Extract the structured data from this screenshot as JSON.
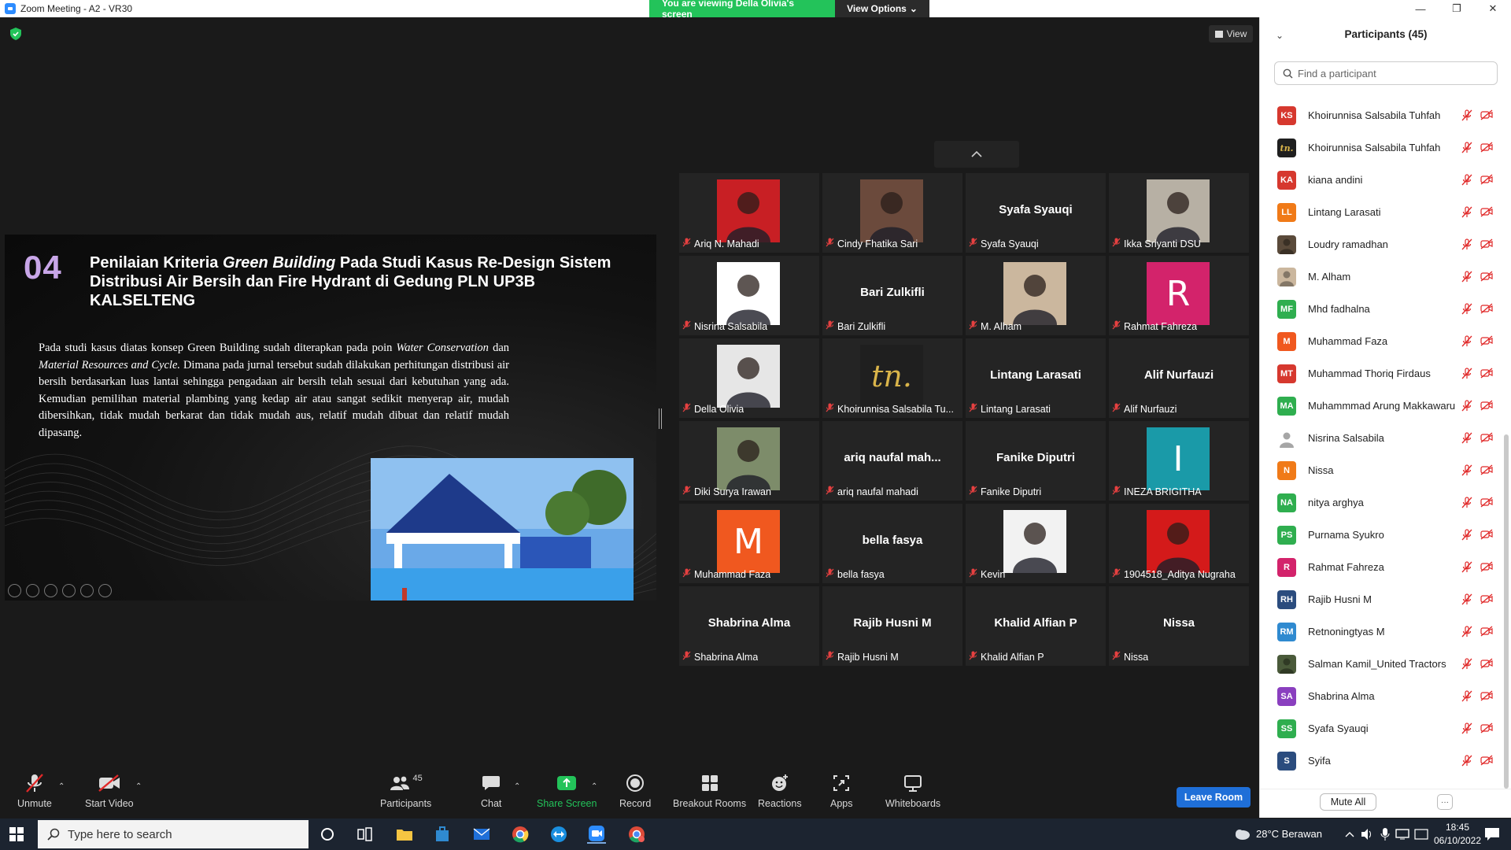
{
  "window": {
    "title": "Zoom Meeting - A2 - VR30",
    "banner_text": "You are viewing Della Olivia's screen",
    "view_options_label": "View Options",
    "view_label": "View"
  },
  "slide": {
    "number": "04",
    "title_part1": "Penilaian Kriteria ",
    "title_italic": "Green Building",
    "title_part2": " Pada Studi Kasus Re-Design Sistem Distribusi Air Bersih dan Fire Hydrant di Gedung PLN UP3B KALSELTENG",
    "body_part1": "Pada studi kasus diatas konsep Green Building sudah diterapkan pada poin ",
    "body_italic1": "Water Conservation",
    "body_part2": " dan ",
    "body_italic2": "Material Resources and Cycle.",
    "body_part3": " Dimana pada jurnal tersebut sudah dilakukan perhitungan distribusi air bersih berdasarkan luas lantai sehingga pengadaan air bersih telah sesuai dari kebutuhan yang ada. Kemudian pemilihan material plambing yang kedap air atau sangat sedikit menyerap air, mudah dibersihkan, tidak mudah berkarat dan tidak mudah aus, relatif mudah dibuat dan relatif mudah dipasang."
  },
  "gallery": [
    {
      "name": "Ariq N. Mahadi",
      "type": "photo",
      "color": "#c81f24"
    },
    {
      "name": "Cindy Fhatika Sari",
      "type": "photo",
      "color": "#6b4a3c"
    },
    {
      "name": "Syafa Syauqi",
      "type": "text",
      "big": "Syafa Syauqi"
    },
    {
      "name": "Ikka Sriyanti DSU",
      "type": "photo",
      "color": "#b7b0a4"
    },
    {
      "name": "Nisrina Salsabila",
      "type": "photo",
      "color": "#ffffff"
    },
    {
      "name": "Bari Zulkifli",
      "type": "text",
      "big": "Bari Zulkifli"
    },
    {
      "name": "M. Alham",
      "type": "photo",
      "color": "#cbb79e"
    },
    {
      "name": "Rahmat Fahreza",
      "type": "letter",
      "letter": "R",
      "color": "#d3236b"
    },
    {
      "name": "Della Olivia",
      "type": "photo",
      "color": "#e6e6e6"
    },
    {
      "name": "Khoirunnisa Salsabila Tu...",
      "type": "logo",
      "letter": "tn.",
      "color": "#1f1f1f"
    },
    {
      "name": "Lintang Larasati",
      "type": "text",
      "big": "Lintang Larasati"
    },
    {
      "name": "Alif Nurfauzi",
      "type": "text",
      "big": "Alif Nurfauzi"
    },
    {
      "name": "Diki Surya Irawan",
      "type": "photo",
      "color": "#7d8c6a"
    },
    {
      "name": "ariq naufal mahadi",
      "type": "text",
      "big": "ariq naufal mah..."
    },
    {
      "name": "Fanike Diputri",
      "type": "text",
      "big": "Fanike Diputri"
    },
    {
      "name": "INEZA BRIGITHA",
      "type": "letter",
      "letter": "I",
      "color": "#1a9aa8"
    },
    {
      "name": "Muhammad Faza",
      "type": "letter",
      "letter": "M",
      "color": "#f0581f"
    },
    {
      "name": "bella fasya",
      "type": "text",
      "big": "bella fasya"
    },
    {
      "name": "Kevin",
      "type": "photo",
      "color": "#f2f2f2"
    },
    {
      "name": "1904518_Aditya Nugraha",
      "type": "photo",
      "color": "#d41a1a"
    },
    {
      "name": "Shabrina Alma",
      "type": "text",
      "big": "Shabrina Alma"
    },
    {
      "name": "Rajib Husni M",
      "type": "text",
      "big": "Rajib Husni M"
    },
    {
      "name": "Khalid Alfian P",
      "type": "text",
      "big": "Khalid Alfian P"
    },
    {
      "name": "Nissa",
      "type": "text",
      "big": "Nissa"
    }
  ],
  "toolbar": {
    "unmute": "Unmute",
    "start_video": "Start Video",
    "participants": "Participants",
    "participants_count": "45",
    "chat": "Chat",
    "share_screen": "Share Screen",
    "record": "Record",
    "breakout_rooms": "Breakout Rooms",
    "reactions": "Reactions",
    "apps": "Apps",
    "whiteboards": "Whiteboards",
    "leave_room": "Leave Room"
  },
  "panel": {
    "title": "Participants (45)",
    "search_placeholder": "Find a participant",
    "mute_all": "Mute All",
    "more": "···",
    "participants": [
      {
        "initials": "KS",
        "name": "Khoirunnisa Salsabila Tuhfah",
        "color": "#d6382e"
      },
      {
        "initials": "tn.",
        "name": "Khoirunnisa Salsabila Tuhfah",
        "color": "#1f1f1f"
      },
      {
        "initials": "KA",
        "name": "kiana andini",
        "color": "#d6382e"
      },
      {
        "initials": "LL",
        "name": "Lintang Larasati",
        "color": "#f07a18"
      },
      {
        "initials": "",
        "name": "Loudry ramadhan",
        "color": "#5a4a3a"
      },
      {
        "initials": "",
        "name": "M. Alham",
        "color": "#cbb79e"
      },
      {
        "initials": "MF",
        "name": "Mhd fadhalna",
        "color": "#2fae4f"
      },
      {
        "initials": "M",
        "name": "Muhammad Faza",
        "color": "#f0581f"
      },
      {
        "initials": "MT",
        "name": "Muhammad Thoriq Firdaus",
        "color": "#d6382e"
      },
      {
        "initials": "MA",
        "name": "Muhammmad Arung Makkawaru",
        "color": "#2fae4f"
      },
      {
        "initials": "",
        "name": "Nisrina Salsabila",
        "color": "#ffffff"
      },
      {
        "initials": "N",
        "name": "Nissa",
        "color": "#f07a18"
      },
      {
        "initials": "NA",
        "name": "nitya arghya",
        "color": "#2fae4f"
      },
      {
        "initials": "PS",
        "name": "Purnama Syukro",
        "color": "#2fae4f"
      },
      {
        "initials": "R",
        "name": "Rahmat Fahreza",
        "color": "#d3236b"
      },
      {
        "initials": "RH",
        "name": "Rajib Husni M",
        "color": "#2b4c7e"
      },
      {
        "initials": "RM",
        "name": "Retnoningtyas M",
        "color": "#2f8ad0"
      },
      {
        "initials": "",
        "name": "Salman Kamil_United Tractors",
        "color": "#4a5a3a"
      },
      {
        "initials": "SA",
        "name": "Shabrina Alma",
        "color": "#8a3fbf"
      },
      {
        "initials": "SS",
        "name": "Syafa Syauqi",
        "color": "#2fae4f"
      },
      {
        "initials": "S",
        "name": "Syifa",
        "color": "#2b4c7e"
      }
    ]
  },
  "taskbar": {
    "search_placeholder": "Type here to search",
    "weather": "28°C  Berawan",
    "time": "18:45",
    "date": "06/10/2022"
  }
}
